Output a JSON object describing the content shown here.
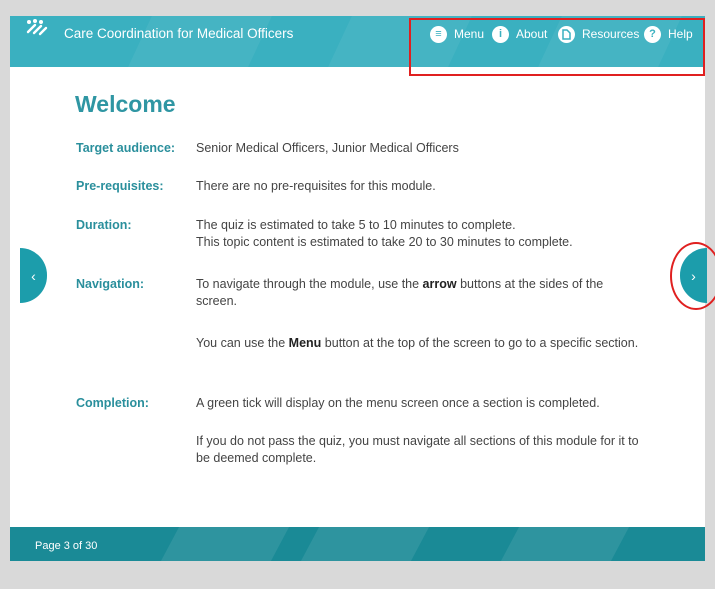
{
  "app": {
    "title": "Care Coordination for Medical Officers"
  },
  "nav": {
    "menu": {
      "label": "Menu",
      "icon": "menu-icon"
    },
    "about": {
      "label": "About",
      "icon": "info-icon"
    },
    "resources": {
      "label": "Resources",
      "icon": "resources-icon"
    },
    "help": {
      "label": "Help",
      "icon": "help-icon"
    }
  },
  "page": {
    "heading": "Welcome",
    "target_label": "Target audience:",
    "target_text": "Senior Medical Officers, Junior Medical Officers",
    "prereq_label": "Pre-requisites:",
    "prereq_text": "There are no pre-requisites for this module.",
    "duration_label": "Duration:",
    "duration_line1": "The quiz is estimated to take 5 to 10 minutes to complete.",
    "duration_line2": "This topic content is estimated to take 20 to 30 minutes to complete.",
    "navigation_label": "Navigation:",
    "navigation_p1_before": "To navigate through the module, use the ",
    "navigation_p1_bold": "arrow",
    "navigation_p1_after": " buttons at the sides of the screen.",
    "navigation_p2_before": "You can use the ",
    "navigation_p2_bold": "Menu",
    "navigation_p2_after": " button at the top of the screen to go to a specific section.",
    "completion_label": "Completion:",
    "completion_p1": "A green tick will display on the menu screen once a section is completed.",
    "completion_p2": "If you do not pass the quiz, you must navigate all sections of this module for it to be deemed complete."
  },
  "footer": {
    "page_indicator": "Page 3 of 30"
  },
  "colors": {
    "header": "#3ab0c0",
    "footer": "#1a8a96",
    "heading": "#2f96a3",
    "label": "#2a8f9c",
    "side_button": "#1c9dab",
    "highlight": "#e02020"
  }
}
